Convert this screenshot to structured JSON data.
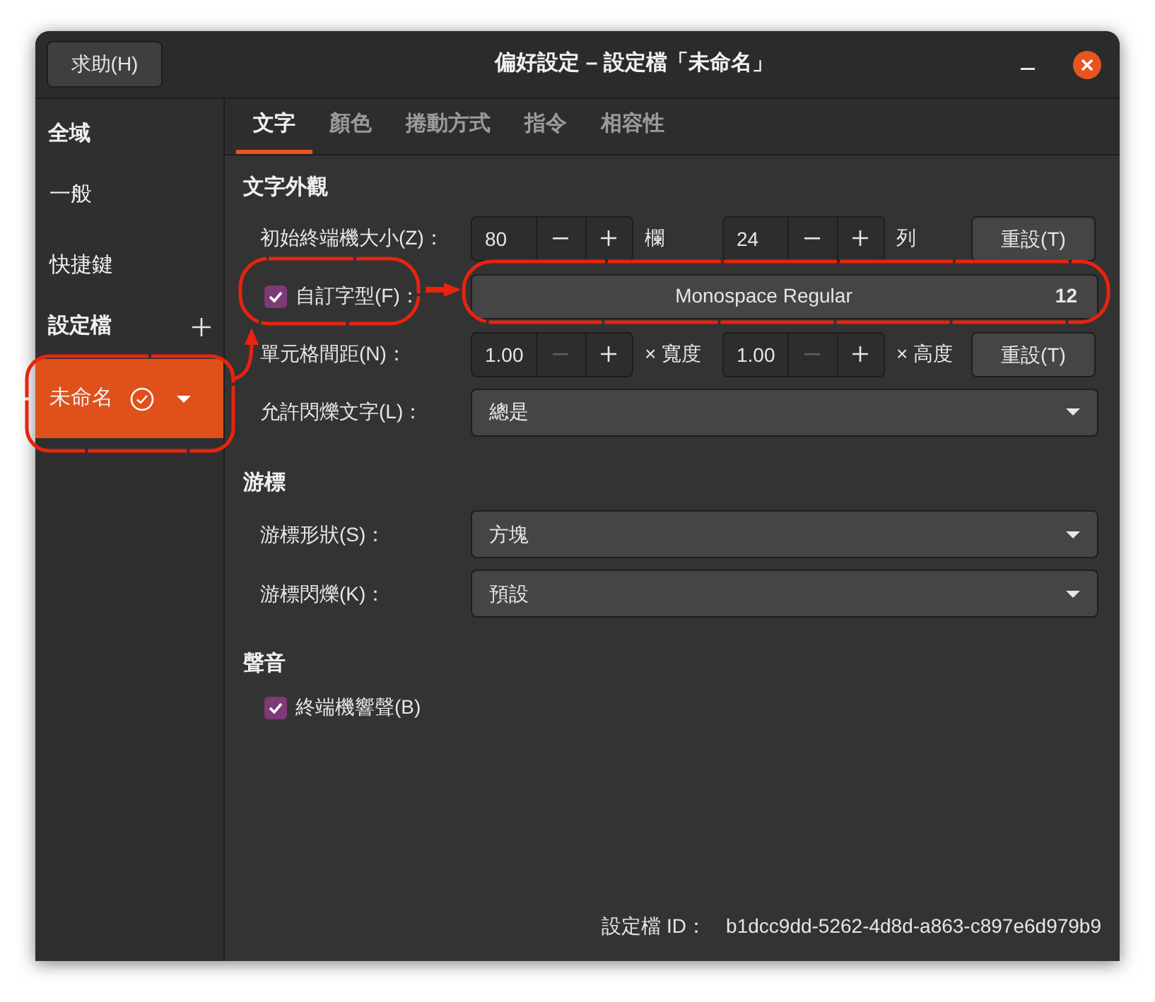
{
  "window": {
    "title": "偏好設定 – 設定檔「未命名」",
    "help_button": "求助(H)"
  },
  "sidebar": {
    "sections": [
      {
        "title": "全域",
        "add_button": false,
        "items": [
          {
            "label": "一般",
            "kind": "page",
            "selected": false
          },
          {
            "label": "快捷鍵",
            "kind": "page",
            "selected": false
          }
        ]
      },
      {
        "title": "設定檔",
        "add_button": true,
        "items": [
          {
            "label": "未命名",
            "kind": "profile",
            "selected": true
          }
        ]
      }
    ]
  },
  "tabs": [
    {
      "label": "文字",
      "selected": true
    },
    {
      "label": "顏色",
      "selected": false
    },
    {
      "label": "捲動方式",
      "selected": false
    },
    {
      "label": "指令",
      "selected": false
    },
    {
      "label": "相容性",
      "selected": false
    }
  ],
  "sections": [
    {
      "title": "文字外觀",
      "rows": [
        {
          "kind": "spin_pair",
          "label": "初始終端機大小(Z)：",
          "spins": [
            {
              "value": "80",
              "decrement_disabled": false,
              "unit": "欄"
            },
            {
              "value": "24",
              "decrement_disabled": false,
              "unit": "列"
            }
          ],
          "reset": "重設(T)"
        },
        {
          "kind": "font",
          "label": "自訂字型(F)：",
          "checked": true,
          "font": "Monospace Regular",
          "size": "12"
        },
        {
          "kind": "spin_pair",
          "label": "單元格間距(N)：",
          "spins": [
            {
              "value": "1.00",
              "decrement_disabled": true,
              "unit": "× 寬度"
            },
            {
              "value": "1.00",
              "decrement_disabled": true,
              "unit": "× 高度"
            }
          ],
          "reset": "重設(T)"
        },
        {
          "kind": "select",
          "label": "允許閃爍文字(L)：",
          "value": "總是"
        }
      ]
    },
    {
      "title": "游標",
      "rows": [
        {
          "kind": "select",
          "label": "游標形狀(S)：",
          "value": "方塊"
        },
        {
          "kind": "select",
          "label": "游標閃爍(K)：",
          "value": "預設"
        }
      ]
    },
    {
      "title": "聲音",
      "rows": [
        {
          "kind": "checkbox",
          "label": "終端機響聲(B)",
          "checked": true
        }
      ]
    }
  ],
  "footer": {
    "label": "設定檔 ID：",
    "value": "b1dcc9dd-5262-4d8d-a863-c897e6d979b9"
  }
}
